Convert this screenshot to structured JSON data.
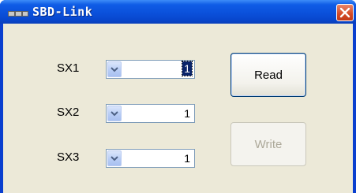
{
  "window": {
    "title": "SBD-Link",
    "close_icon": "close-icon",
    "app_icon": "app-icon"
  },
  "fields": [
    {
      "label": "SX1",
      "value": "1",
      "selected": true
    },
    {
      "label": "SX2",
      "value": "1",
      "selected": false
    },
    {
      "label": "SX3",
      "value": "1",
      "selected": false
    }
  ],
  "buttons": {
    "read_label": "Read",
    "write_label": "Write",
    "write_enabled": false
  },
  "colors": {
    "titlebar": "#0a4fd9",
    "close": "#d44a26",
    "client_bg": "#ece9d8",
    "selection": "#0a246a"
  }
}
